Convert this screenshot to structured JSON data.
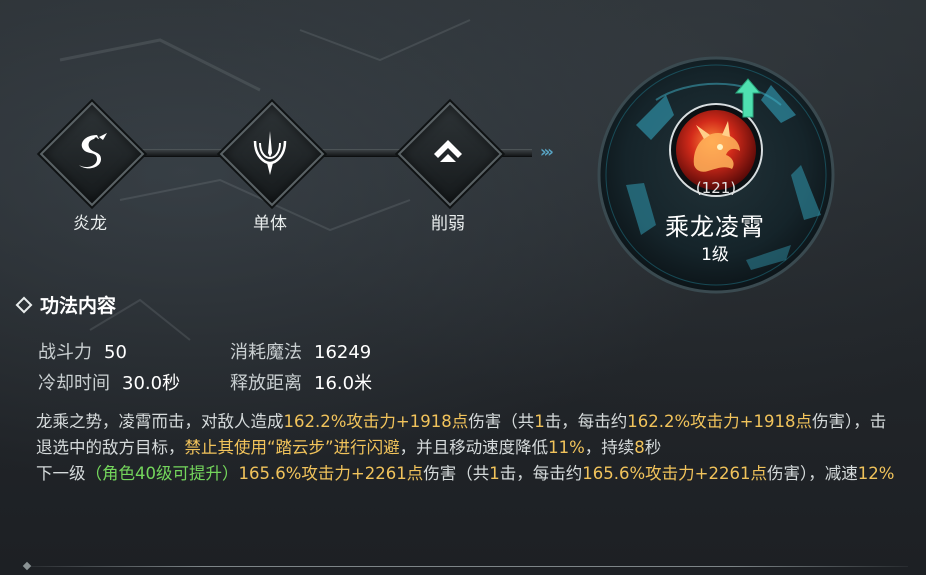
{
  "skill_chain": [
    {
      "label": "炎龙",
      "icon": "dragon-icon"
    },
    {
      "label": "单体",
      "icon": "single-target-icon"
    },
    {
      "label": "削弱",
      "icon": "weaken-icon"
    }
  ],
  "main_skill": {
    "name": "乘龙凌霄",
    "level": "1级",
    "code": "(121)",
    "icon": "red-dragon-skill-icon",
    "upgrade_arrow_color": "#4fe0b0"
  },
  "section": {
    "title": "功法内容"
  },
  "stats": {
    "combat_power_label": "战斗力",
    "combat_power_value": "50",
    "mana_cost_label": "消耗魔法",
    "mana_cost_value": "16249",
    "cooldown_label": "冷却时间",
    "cooldown_value": "30.0秒",
    "cast_range_label": "释放距离",
    "cast_range_value": "16.0米"
  },
  "description": {
    "p1": "龙乘之势，凌霄而击，对敌人造成",
    "p2": "162.2%攻击力+1918点",
    "p3": "伤害（共",
    "p4": "1",
    "p5": "击，每击约",
    "p6": "162.2%攻击力+1918点",
    "p7": "伤害），击退选中的敌方目标，",
    "p8": "禁止其使用“踏云步”进行闪避",
    "p9": "，并且移动速度降低",
    "p10": "11%",
    "p11": "，持续",
    "p12": "8",
    "p13": "秒"
  },
  "next_level": {
    "prefix": "下一级",
    "requirement": "（角色40级可提升）",
    "p1": "165.6%攻击力+2261点",
    "p2": "伤害（共",
    "p3": "1",
    "p4": "击，每击约",
    "p5": "165.6%攻击力+2261点",
    "p6": "伤害），减速",
    "p7": "12%"
  },
  "colors": {
    "highlight_yellow": "#f1c35b",
    "highlight_green": "#74d65c",
    "accent_teal": "#2f8fa5"
  }
}
